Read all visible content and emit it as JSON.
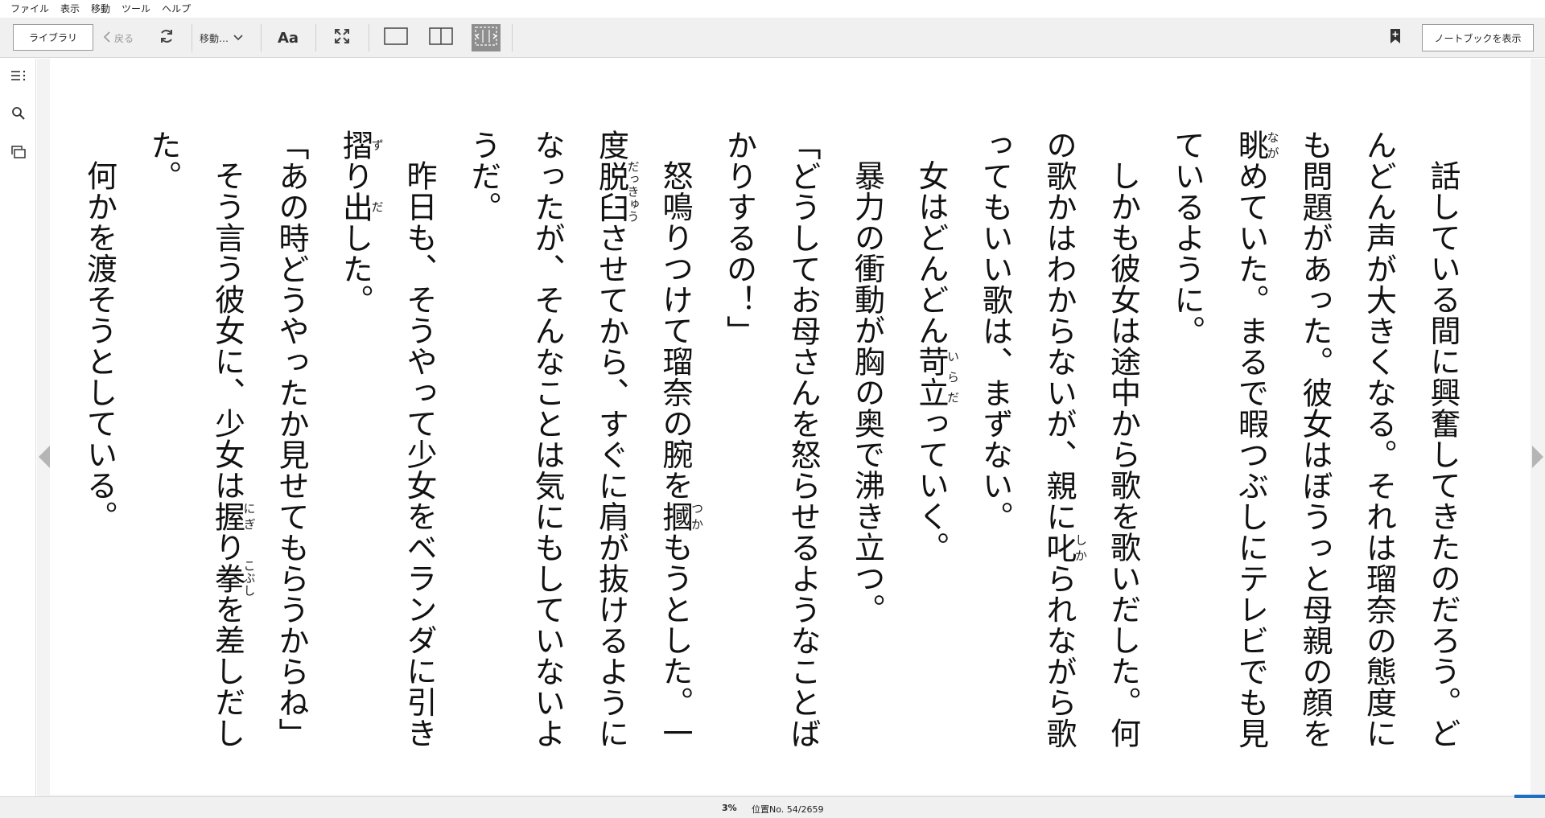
{
  "menu": [
    "ファイル",
    "表示",
    "移動",
    "ツール",
    "ヘルプ"
  ],
  "toolbar": {
    "library_label": "ライブラリ",
    "back_label": "戻る",
    "goto_label": "移動…",
    "font_label": "Aa",
    "notebook_label": "ノートブックを表示"
  },
  "icons": {
    "refresh": "refresh-icon",
    "fullscreen": "fullscreen-icon",
    "single_column": "single-column-icon",
    "two_column": "two-column-icon",
    "fit_width": "fit-width-icon",
    "bookmark": "bookmark-icon",
    "toc": "table-of-contents-icon",
    "search": "search-icon",
    "flashcards": "flashcards-icon"
  },
  "colors": {
    "accent": "#1e6fc2",
    "toolbar_bg": "#f0f0f0",
    "active_button": "#8e8e8e"
  },
  "content": {
    "paragraphs": [
      {
        "indent": true,
        "segments": [
          {
            "t": "話している間に興奮してきたのだろう。どんどん声が大きくなる。それは瑠奈の態度にも問題があった。彼女はぼうっと母親の顔を"
          },
          {
            "t": "眺",
            "r": "なが"
          },
          {
            "t": "めていた。まるで暇つぶしにテレビでも見ているように。"
          }
        ]
      },
      {
        "indent": true,
        "segments": [
          {
            "t": "しかも彼女は途中から歌を歌いだした。何の歌かはわからないが、親に"
          },
          {
            "t": "叱",
            "r": "しか"
          },
          {
            "t": "られながら歌ってもいい歌は、まずない。"
          }
        ]
      },
      {
        "indent": true,
        "segments": [
          {
            "t": "女はどんどん"
          },
          {
            "t": "苛立",
            "r": "いらだ"
          },
          {
            "t": "っていく。"
          }
        ]
      },
      {
        "indent": true,
        "segments": [
          {
            "t": "暴力の衝動が胸の奥で沸き立つ。"
          }
        ]
      },
      {
        "indent": false,
        "segments": [
          {
            "t": "「どうしてお母さんを怒らせるようなことばかりするの！」"
          }
        ]
      },
      {
        "indent": true,
        "segments": [
          {
            "t": "怒鳴りつけて瑠奈の腕を"
          },
          {
            "t": "摑",
            "r": "つか"
          },
          {
            "t": "もうとした。一度"
          },
          {
            "t": "脱臼",
            "r": "だっきゅう"
          },
          {
            "t": "させてから、すぐに肩が抜けるようになったが、そんなことは気にもしていないようだ。"
          }
        ]
      },
      {
        "indent": true,
        "segments": [
          {
            "t": "昨日も、そうやって少女をベランダに引き"
          },
          {
            "t": "摺",
            "r": "ず"
          },
          {
            "t": "り"
          },
          {
            "t": "出",
            "r": "だ"
          },
          {
            "t": "した。"
          }
        ]
      },
      {
        "indent": false,
        "segments": [
          {
            "t": "「あの時どうやったか見せてもらうからね」"
          }
        ]
      },
      {
        "indent": true,
        "segments": [
          {
            "t": "そう言う彼女に、少女は"
          },
          {
            "t": "握",
            "r": "にぎ"
          },
          {
            "t": "り"
          },
          {
            "t": "拳",
            "r": "こぶし"
          },
          {
            "t": "を差しだした。"
          }
        ]
      },
      {
        "indent": true,
        "segments": [
          {
            "t": "何かを渡そうとしている。"
          }
        ]
      }
    ]
  },
  "status": {
    "percent": "3%",
    "location": "位置No. 54/2659",
    "progress_fraction": 0.03
  }
}
